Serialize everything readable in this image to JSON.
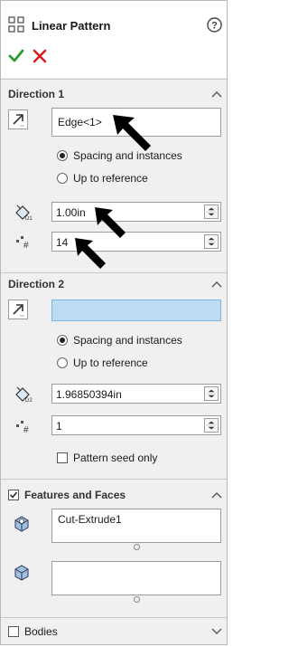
{
  "header": {
    "title": "Linear Pattern",
    "help_icon": "help-icon",
    "ok_icon": "check-icon",
    "cancel_icon": "close-icon"
  },
  "direction1": {
    "title": "Direction 1",
    "reference_value": "Edge<1>",
    "radio_spacing_label": "Spacing and instances",
    "radio_up_label": "Up to reference",
    "spacing_value": "1.00in",
    "instances_value": "14",
    "selected_option": "Spacing and instances"
  },
  "direction2": {
    "title": "Direction 2",
    "reference_value": "",
    "radio_spacing_label": "Spacing and instances",
    "radio_up_label": "Up to reference",
    "spacing_value": "1.96850394in",
    "instances_value": "1",
    "seed_only_label": "Pattern seed only",
    "seed_only_checked": false,
    "selected_option": "Spacing and instances"
  },
  "features": {
    "title": "Features and Faces",
    "checked": true,
    "feature_item": "Cut-Extrude1",
    "faces_value": ""
  },
  "bodies": {
    "title": "Bodies",
    "checked": false
  },
  "colors": {
    "panel_bg": "#f0f0f0",
    "selection_highlight": "#bcdcf4",
    "ok_green": "#2e9a2e",
    "cancel_red": "#d42020"
  }
}
